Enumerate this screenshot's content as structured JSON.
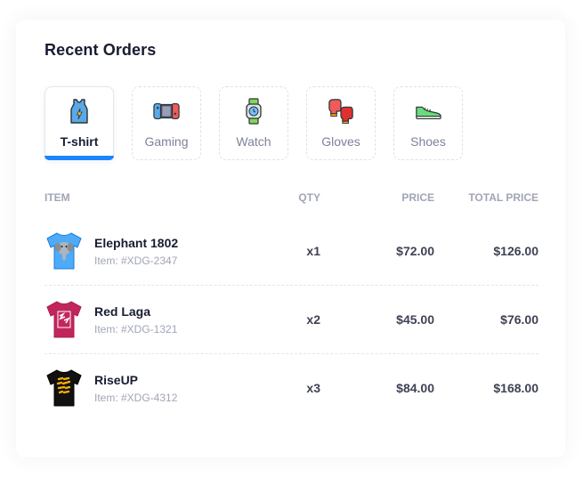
{
  "card": {
    "title": "Recent Orders"
  },
  "tabs": [
    {
      "label": "T-shirt",
      "icon": "tank-top-icon",
      "active": true
    },
    {
      "label": "Gaming",
      "icon": "game-console-icon",
      "active": false
    },
    {
      "label": "Watch",
      "icon": "smartwatch-icon",
      "active": false
    },
    {
      "label": "Gloves",
      "icon": "boxing-gloves-icon",
      "active": false
    },
    {
      "label": "Shoes",
      "icon": "sneaker-icon",
      "active": false
    }
  ],
  "table": {
    "headers": {
      "item": "ITEM",
      "qty": "QTY",
      "price": "PRICE",
      "total": "TOTAL PRICE"
    },
    "rows": [
      {
        "name": "Elephant 1802",
        "code": "Item: #XDG-2347",
        "qty": "x1",
        "price": "$72.00",
        "total": "$126.00",
        "thumb": "blue-elephant-tshirt-icon"
      },
      {
        "name": "Red Laga",
        "code": "Item: #XDG-1321",
        "qty": "x2",
        "price": "$45.00",
        "total": "$76.00",
        "thumb": "red-tshirt-icon"
      },
      {
        "name": "RiseUP",
        "code": "Item: #XDG-4312",
        "qty": "x3",
        "price": "$84.00",
        "total": "$168.00",
        "thumb": "black-tshirt-icon"
      }
    ]
  },
  "colors": {
    "accent": "#1b84ff",
    "heading": "#181c32",
    "muted": "#a1a5b7"
  }
}
